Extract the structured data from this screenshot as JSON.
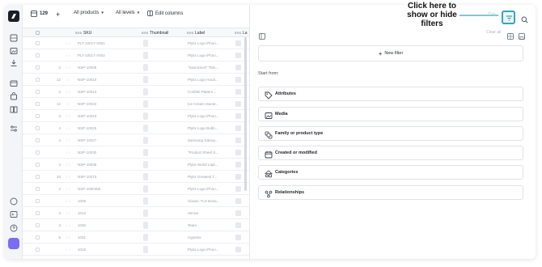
{
  "callout": {
    "text_lines": [
      "Click here to",
      "show or hide",
      "filters"
    ],
    "tab_hint": "Tab"
  },
  "toolbar": {
    "count": "129",
    "products_filter": "All products",
    "levels_filter": "All levels",
    "edit_columns": "Edit columns"
  },
  "table": {
    "columns": [
      {
        "prefix": "SYS",
        "label": "SKU"
      },
      {
        "prefix": "SYS",
        "label": "Thumbnail"
      },
      {
        "prefix": "SYS",
        "label": "Label"
      },
      {
        "prefix": "SYS",
        "label": "La"
      }
    ],
    "rows": [
      {
        "level": "",
        "count": "",
        "sku": "PLT-10017-V001",
        "label": "Plytix Logo iPhon..."
      },
      {
        "level": "",
        "count": "",
        "sku": "PLT-10017-V002",
        "label": "Plytix Logo iPhon..."
      },
      {
        "level": "2",
        "count": "",
        "sku": "NSP-10009",
        "label": "\"Seal Excel\" Tote..."
      },
      {
        "level": "12",
        "count": "",
        "sku": "NSP-10010",
        "label": "Plytix Logo Hood..."
      },
      {
        "level": "2",
        "count": "",
        "sku": "NSP-10013",
        "label": "Confetti Pattern..."
      },
      {
        "level": "12",
        "count": "",
        "sku": "NSP-10022",
        "label": "Ice Cream Sweat..."
      },
      {
        "level": "3",
        "count": "",
        "sku": "NSP-10023",
        "label": "Plytix Logo iPhon..."
      },
      {
        "level": "4",
        "count": "",
        "sku": "NSP-10025",
        "label": "Plytix Logo Bubb..."
      },
      {
        "level": "4",
        "count": "",
        "sku": "NSP-10027",
        "label": "Samsung Galaxy..."
      },
      {
        "level": "",
        "count": "",
        "sku": "NSP-10030",
        "label": "\"Product Sheet S..."
      },
      {
        "level": "4",
        "count": "",
        "sku": "NSP-10036",
        "label": "Plytix World Lapt..."
      },
      {
        "level": "10",
        "count": "",
        "sku": "NSP-10073",
        "label": "Plytix Greatest T..."
      },
      {
        "level": "2",
        "count": "",
        "sku": "NSP-1000456",
        "label": "Plytix Logo iPhon..."
      },
      {
        "level": "",
        "count": "",
        "sku": "1039",
        "label": "Classic TLS Bona..."
      },
      {
        "level": "3",
        "count": "",
        "sku": "1013",
        "label": "Venice"
      },
      {
        "level": "4",
        "count": "",
        "sku": "1030",
        "label": "Team"
      },
      {
        "level": "5",
        "count": "",
        "sku": "1031",
        "label": "Cypress"
      },
      {
        "level": "",
        "count": "",
        "sku": "1018",
        "label": "Plytix Logo iPhon..."
      }
    ]
  },
  "filter_panel": {
    "clear_label": "Clear all",
    "new_filter": "New filter",
    "start_from": "Start from:",
    "options": [
      {
        "label": "Attributes",
        "icon": "tag-icon"
      },
      {
        "label": "Media",
        "icon": "image-icon"
      },
      {
        "label": "Family or product type",
        "icon": "family-icon"
      },
      {
        "label": "Created or modified",
        "icon": "calendar-icon"
      },
      {
        "label": "Categories",
        "icon": "categories-icon"
      },
      {
        "label": "Relationships",
        "icon": "relationships-icon"
      }
    ]
  },
  "colors": {
    "accent": "#3aa5b8",
    "active_rail": "#7b6cf6"
  }
}
